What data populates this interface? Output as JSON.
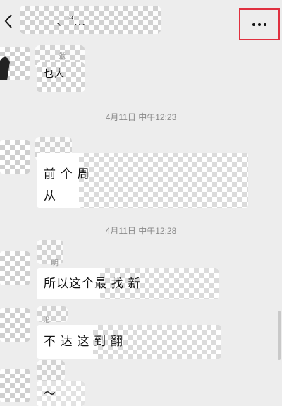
{
  "header": {
    "back_icon": "chevron-left-icon",
    "title": "、“…",
    "more_icon": "more-dots-icon",
    "highlight_color": "#e0303f"
  },
  "messages": [
    {
      "type": "incoming",
      "name": "张",
      "text": "也人"
    },
    {
      "type": "time",
      "text": "4月11日 中午12:23"
    },
    {
      "type": "incoming",
      "name": "",
      "text_line1": "前 个 周",
      "text_line2": "从"
    },
    {
      "type": "time",
      "text": "4月11日 中午12:28"
    },
    {
      "type": "incoming",
      "name": "明",
      "text": "所以这个最 找 新"
    },
    {
      "type": "incoming",
      "name": "论",
      "text": "不 达 这 到 翻"
    },
    {
      "type": "incoming",
      "name": "",
      "text": "〜"
    }
  ]
}
